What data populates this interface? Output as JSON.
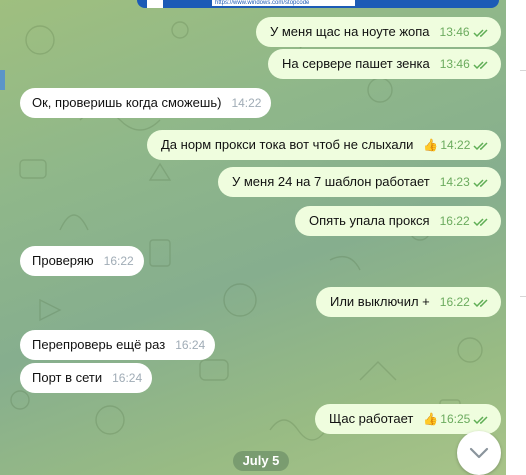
{
  "screenshot_preview": {
    "url_text": "https://www.windows.com/stopcode"
  },
  "messages": [
    {
      "dir": "out",
      "text": "У меня щас на ноуте жопа",
      "time": "13:46",
      "read": true
    },
    {
      "dir": "out",
      "text": "На сервере пашет зенка",
      "time": "13:46",
      "read": true
    },
    {
      "dir": "in",
      "text": "Ок, проверишь когда сможешь)",
      "time": "14:22"
    },
    {
      "dir": "out",
      "text": "Да норм прокси тока вот чтоб не слыхали",
      "time": "14:22",
      "read": true,
      "reaction": "thumbs-up"
    },
    {
      "dir": "out",
      "text": "У меня 24 на 7 шаблон работает",
      "time": "14:23",
      "read": true
    },
    {
      "dir": "out",
      "text": "Опять упала прокся",
      "time": "16:22",
      "read": true
    },
    {
      "dir": "in",
      "text": "Проверяю",
      "time": "16:22"
    },
    {
      "dir": "out",
      "text": "Или выключил +",
      "time": "16:22",
      "read": true
    },
    {
      "dir": "in",
      "text": "Перепроверь ещё раз",
      "time": "16:24"
    },
    {
      "dir": "in",
      "text": "Порт в сети",
      "time": "16:24"
    },
    {
      "dir": "out",
      "text": "Щас работает",
      "time": "16:25",
      "read": true,
      "reaction": "thumbs-up"
    }
  ],
  "date_separator": "July 5",
  "icons": {
    "read_receipt": "double-check-icon",
    "reaction": "thumbs-up-icon",
    "scroll_down": "chevron-down-icon"
  },
  "colors": {
    "outgoing_bubble": "#effdde",
    "incoming_bubble": "#ffffff",
    "outgoing_time": "#6bab5e",
    "incoming_time": "#a0acb6",
    "background": "#8fb78a"
  }
}
